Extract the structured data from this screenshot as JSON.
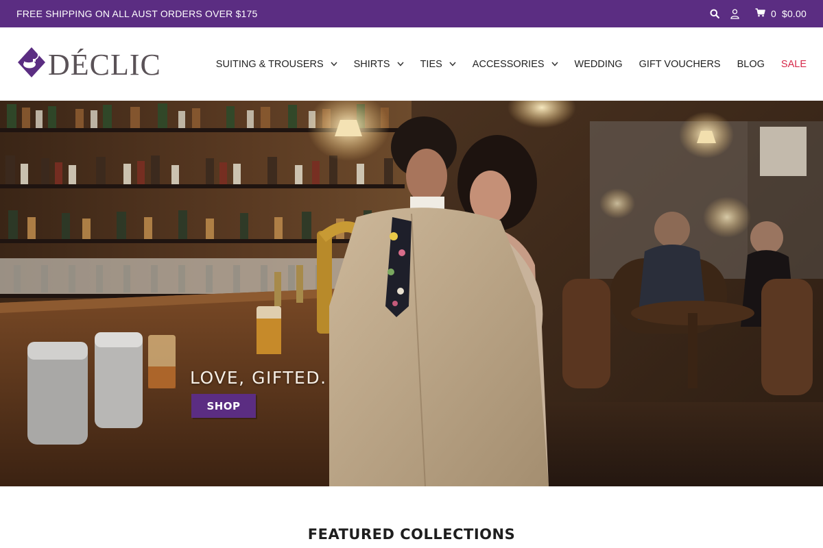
{
  "announcement": {
    "text": "FREE SHIPPING ON ALL AUST ORDERS OVER $175",
    "background_color": "#5b2d82",
    "tools": {
      "search_icon": "search-icon",
      "account_icon": "user-icon",
      "cart_icon": "cart-icon",
      "cart_count": "0",
      "cart_total": "$0.00"
    }
  },
  "logo": {
    "wordmark": "DÉCLIC",
    "emblem_icon": "diamond-emblem-icon"
  },
  "nav": {
    "items": [
      {
        "label": "SUITING & TROUSERS",
        "dropdown": true
      },
      {
        "label": "SHIRTS",
        "dropdown": true
      },
      {
        "label": "TIES",
        "dropdown": true
      },
      {
        "label": "ACCESSORIES",
        "dropdown": true
      },
      {
        "label": "WEDDING",
        "dropdown": false
      },
      {
        "label": "GIFT VOUCHERS",
        "dropdown": false
      },
      {
        "label": "BLOG",
        "dropdown": false
      },
      {
        "label": "SALE",
        "dropdown": false
      }
    ],
    "sale_color": "#d6294a"
  },
  "hero": {
    "heading": "LOVE, GIFTED.",
    "button_label": "SHOP",
    "button_color": "#5b2d82"
  },
  "featured": {
    "title": "FEATURED COLLECTIONS"
  }
}
